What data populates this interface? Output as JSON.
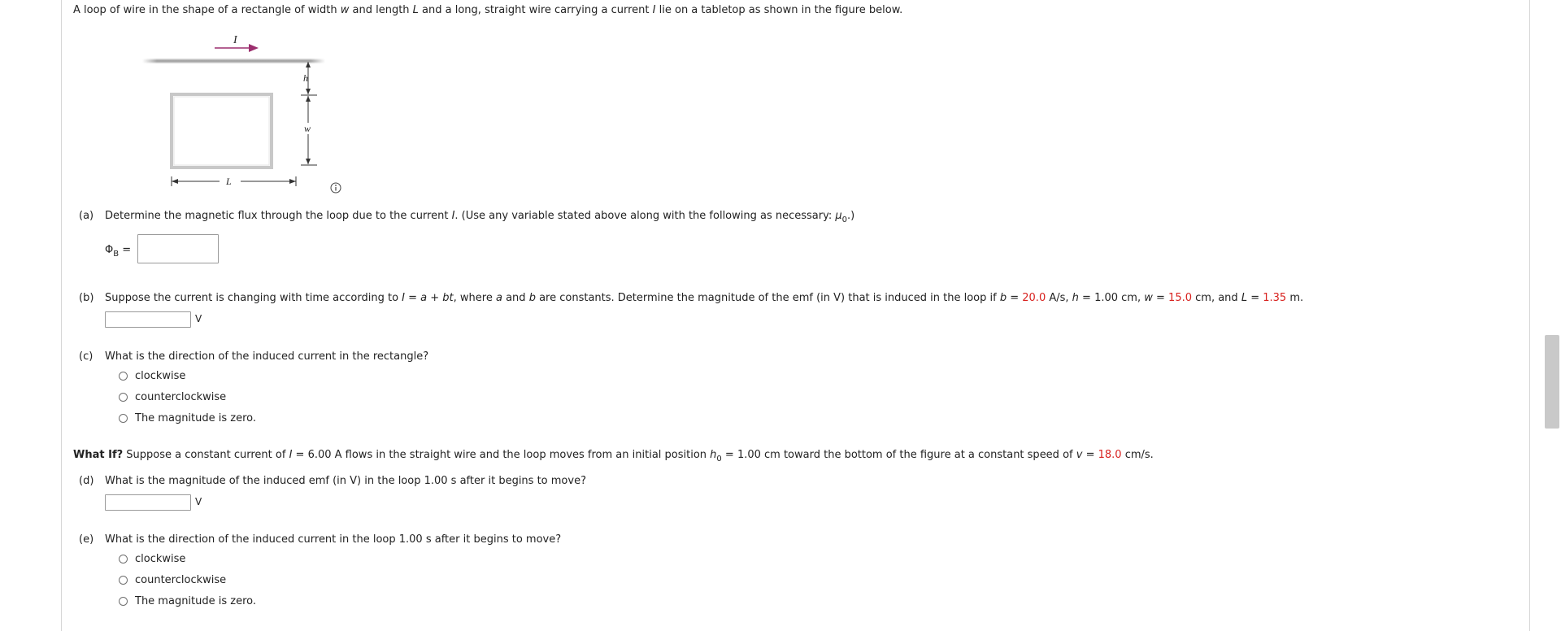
{
  "intro": {
    "p1": "A loop of wire in the shape of a rectangle of width ",
    "w": "w",
    "p2": " and length ",
    "L": "L",
    "p3": " and a long, straight wire carrying a current ",
    "I": "I",
    "p4": " lie on a tabletop as shown in the figure below."
  },
  "figure": {
    "current_label": "I",
    "h_label": "h",
    "w_label": "w",
    "L_label": "L",
    "info_icon": "info-icon",
    "arrow_color": "#9c2f6e"
  },
  "a": {
    "label": "(a)",
    "p1": "Determine the magnetic flux through the loop due to the current ",
    "I": "I",
    "p2": ". (Use any variable stated above along with the following as necessary: ",
    "mu": "μ",
    "mu_sub": "0",
    "p3": ".)",
    "phi": "Φ",
    "phi_sub": "B",
    "eq": "=",
    "value": ""
  },
  "b": {
    "label": "(b)",
    "p1": "Suppose the current is changing with time according to ",
    "formula_I": "I",
    "formula_rest": " = a + bt",
    "p2": ", where ",
    "va": "a",
    "p3": " and ",
    "vb": "b",
    "p4": " are constants. Determine the magnitude of the emf (in V) that is induced in the loop if ",
    "b_var": "b",
    "p5": " = ",
    "b_val": "20.0",
    "p6": " A/s, ",
    "h_var": "h",
    "p7": " = 1.00 cm, ",
    "w_var": "w",
    "p8": " = ",
    "w_val": "15.0",
    "p9": " cm, and ",
    "L_var": "L",
    "p10": " = ",
    "L_val": "1.35",
    "p11": " m.",
    "unit": "V",
    "value": ""
  },
  "c": {
    "label": "(c)",
    "question": "What is the direction of the induced current in the rectangle?",
    "options": [
      "clockwise",
      "counterclockwise",
      "The magnitude is zero."
    ]
  },
  "whatif": {
    "bold": "What If?",
    "p1": " Suppose a constant current of ",
    "I": "I",
    "p2": " = 6.00 A flows in the straight wire and the loop moves from an initial position ",
    "h": "h",
    "h_sub": "0",
    "p3": " = 1.00 cm toward the bottom of the figure at a constant speed of ",
    "v": "v",
    "p4": " = ",
    "v_val": "18.0",
    "p5": " cm/s."
  },
  "d": {
    "label": "(d)",
    "question": "What is the magnitude of the induced emf (in V) in the loop 1.00 s after it begins to move?",
    "unit": "V",
    "value": ""
  },
  "e": {
    "label": "(e)",
    "question": "What is the direction of the induced current in the loop 1.00 s after it begins to move?",
    "options": [
      "clockwise",
      "counterclockwise",
      "The magnitude is zero."
    ]
  }
}
